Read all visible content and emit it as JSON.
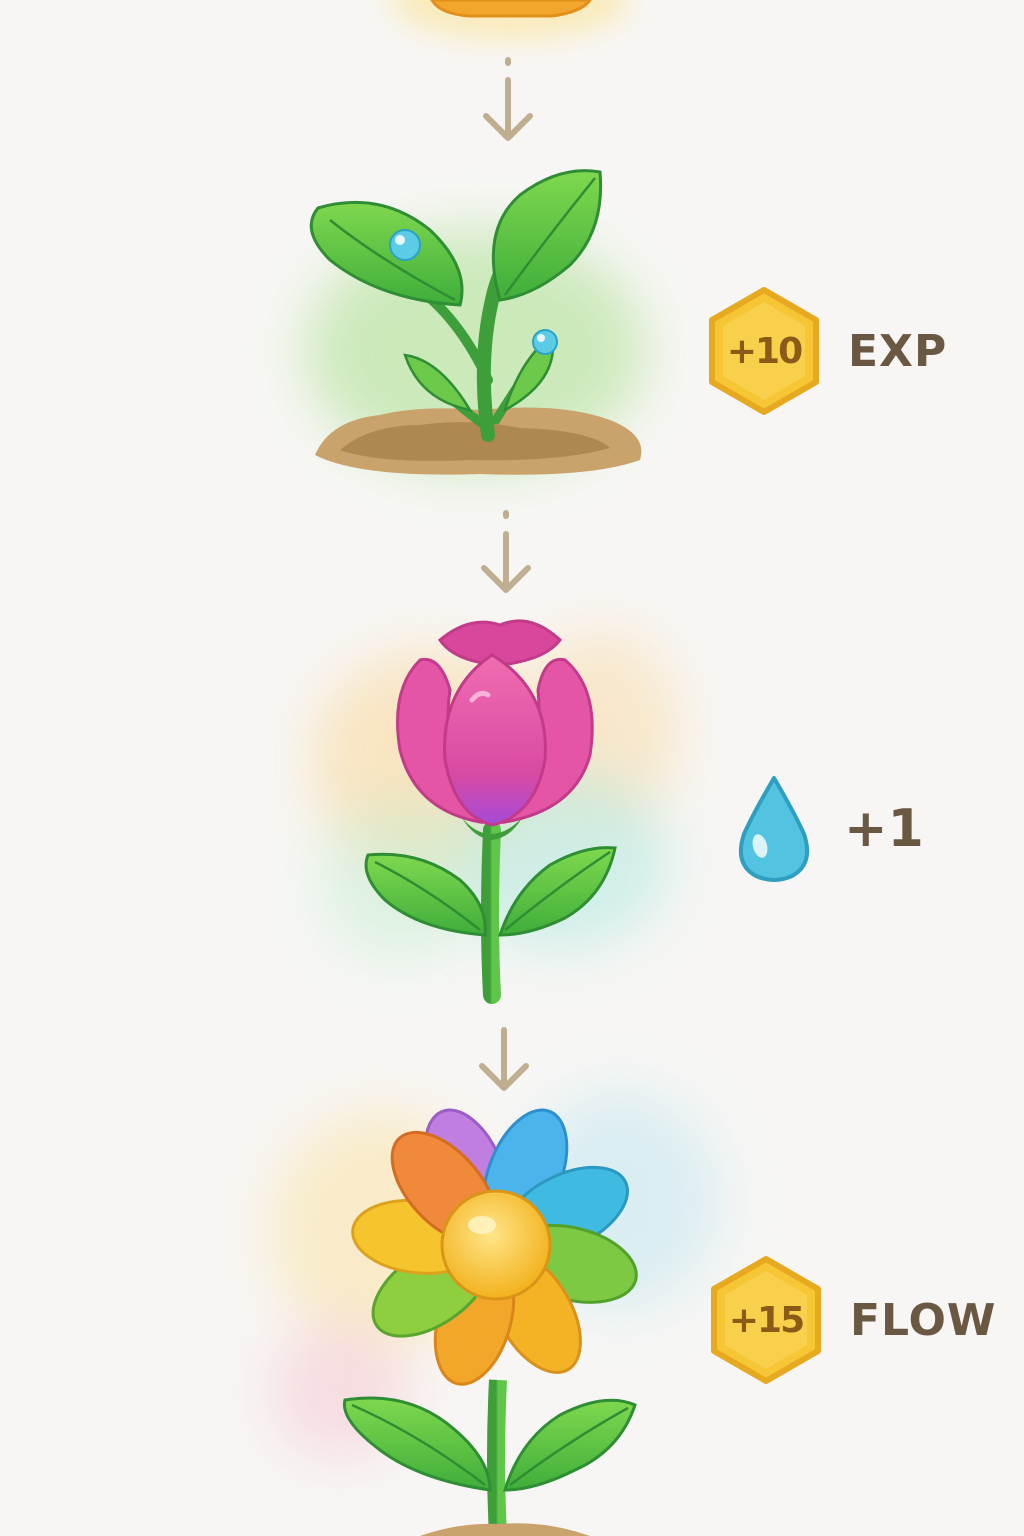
{
  "stages": [
    {
      "id": "seed",
      "name": "seed"
    },
    {
      "id": "sprout",
      "name": "sprout"
    },
    {
      "id": "bud",
      "name": "bud"
    },
    {
      "id": "bloom",
      "name": "rainbow-flower"
    }
  ],
  "rewards": {
    "exp": {
      "amount": "+10",
      "label": "EXP",
      "icon": "hexagon-badge-icon"
    },
    "water": {
      "amount": "+1",
      "icon": "water-drop-icon"
    },
    "flow": {
      "amount": "+15",
      "label": "FLOW",
      "icon": "hexagon-badge-icon"
    }
  },
  "colors": {
    "background": "#f7f6f4",
    "badge_gold": "#f6c635",
    "badge_border": "#e7a91f",
    "text_brown": "#6b5843",
    "arrow": "#bfae8f",
    "water_blue": "#52c3e0"
  }
}
